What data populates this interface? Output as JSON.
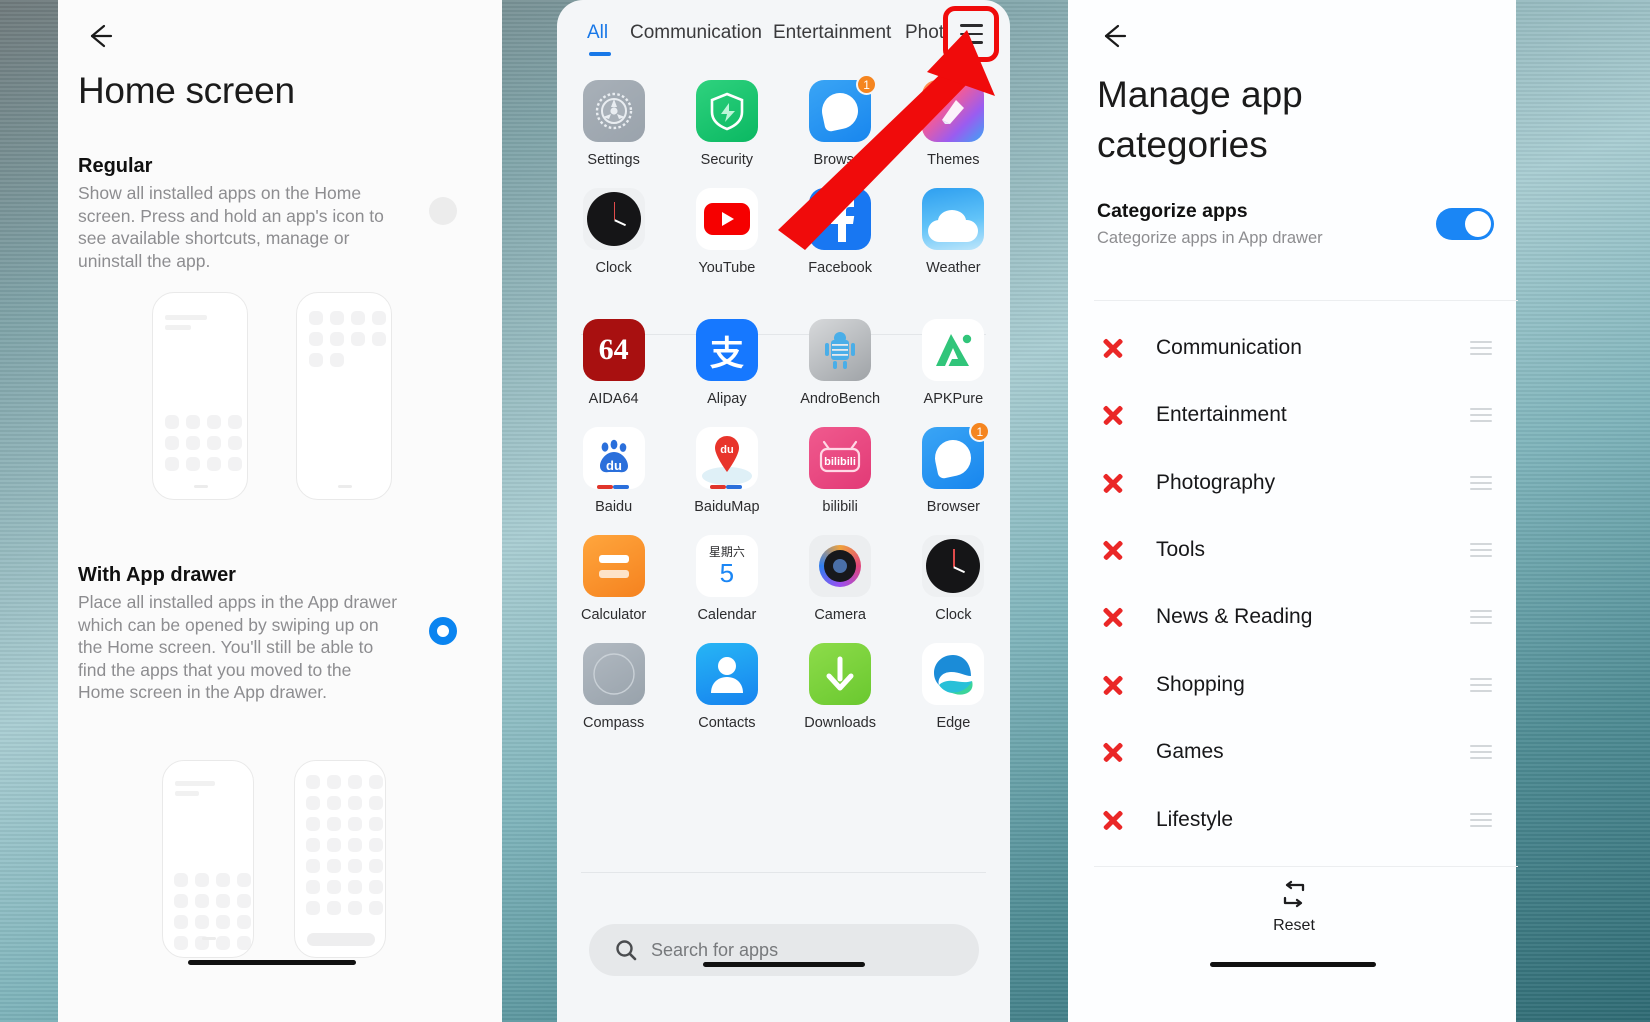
{
  "left_panel": {
    "back_icon": "back-arrow-icon",
    "title": "Home screen",
    "options": [
      {
        "heading": "Regular",
        "body": "Show all installed apps on the Home screen. Press and hold an app's icon to see available shortcuts, manage or uninstall the app.",
        "selected": false
      },
      {
        "heading": "With App drawer",
        "body": "Place all installed apps in the App drawer which can be opened by swiping up on the Home screen. You'll still be able to find the apps that you moved to the Home screen in the App drawer.",
        "selected": true
      }
    ]
  },
  "middle_panel": {
    "tabs": [
      {
        "label": "All",
        "active": true
      },
      {
        "label": "Communication",
        "active": false
      },
      {
        "label": "Entertainment",
        "active": false
      },
      {
        "label": "Phot",
        "active": false
      }
    ],
    "menu_icon": "hamburger-menu-icon",
    "menu_highlight_color": "#f00b0b",
    "apps": [
      {
        "label": "Settings",
        "icon": "settings-gear-icon",
        "badge": null
      },
      {
        "label": "Security",
        "icon": "shield-icon",
        "badge": null
      },
      {
        "label": "Browser",
        "icon": "browser-icon",
        "badge": "1"
      },
      {
        "label": "Themes",
        "icon": "themes-icon",
        "badge": null
      },
      {
        "label": "Clock",
        "icon": "clock-icon",
        "badge": null
      },
      {
        "label": "YouTube",
        "icon": "youtube-icon",
        "badge": null
      },
      {
        "label": "Facebook",
        "icon": "facebook-icon",
        "badge": null
      },
      {
        "label": "Weather",
        "icon": "weather-icon",
        "badge": null
      },
      {
        "label": "AIDA64",
        "icon": "aida64-icon",
        "badge": null
      },
      {
        "label": "Alipay",
        "icon": "alipay-icon",
        "badge": null
      },
      {
        "label": "AndroBench",
        "icon": "androbench-icon",
        "badge": null
      },
      {
        "label": "APKPure",
        "icon": "apkpure-icon",
        "badge": null
      },
      {
        "label": "Baidu",
        "icon": "baidu-icon",
        "badge": null
      },
      {
        "label": "BaiduMap",
        "icon": "baidumap-icon",
        "badge": null
      },
      {
        "label": "bilibili",
        "icon": "bilibili-icon",
        "badge": null
      },
      {
        "label": "Browser",
        "icon": "browser-icon",
        "badge": "1"
      },
      {
        "label": "Calculator",
        "icon": "calculator-icon",
        "badge": null
      },
      {
        "label": "Calendar",
        "icon": "calendar-icon",
        "badge": null
      },
      {
        "label": "Camera",
        "icon": "camera-icon",
        "badge": null
      },
      {
        "label": "Clock",
        "icon": "clock-icon",
        "badge": null
      },
      {
        "label": "Compass",
        "icon": "compass-icon",
        "badge": null
      },
      {
        "label": "Contacts",
        "icon": "contacts-icon",
        "badge": null
      },
      {
        "label": "Downloads",
        "icon": "downloads-icon",
        "badge": null
      },
      {
        "label": "Edge",
        "icon": "edge-icon",
        "badge": null
      }
    ],
    "icon_text": {
      "aida64": "64",
      "alipay": "支",
      "baidu": "du",
      "baidumap": "du",
      "bilibili": "bilibili",
      "calendar_weekday": "星期六",
      "calendar_day": "5"
    },
    "search": {
      "icon": "search-icon",
      "placeholder": "Search for apps",
      "value": ""
    }
  },
  "right_panel": {
    "back_icon": "back-arrow-icon",
    "title": "Manage app categories",
    "setting": {
      "label": "Categorize apps",
      "description": "Categorize apps in App drawer",
      "toggle_on": true,
      "toggle_color": "#1a86f5"
    },
    "categories": [
      {
        "name": "Communication",
        "remove_icon": "remove-x-icon",
        "drag_icon": "drag-handle-icon"
      },
      {
        "name": "Entertainment",
        "remove_icon": "remove-x-icon",
        "drag_icon": "drag-handle-icon"
      },
      {
        "name": "Photography",
        "remove_icon": "remove-x-icon",
        "drag_icon": "drag-handle-icon"
      },
      {
        "name": "Tools",
        "remove_icon": "remove-x-icon",
        "drag_icon": "drag-handle-icon"
      },
      {
        "name": "News & Reading",
        "remove_icon": "remove-x-icon",
        "drag_icon": "drag-handle-icon"
      },
      {
        "name": "Shopping",
        "remove_icon": "remove-x-icon",
        "drag_icon": "drag-handle-icon"
      },
      {
        "name": "Games",
        "remove_icon": "remove-x-icon",
        "drag_icon": "drag-handle-icon"
      },
      {
        "name": "Lifestyle",
        "remove_icon": "remove-x-icon",
        "drag_icon": "drag-handle-icon"
      }
    ],
    "reset": {
      "label": "Reset",
      "icon": "reset-loop-icon"
    }
  },
  "annotation": {
    "arrow_color": "#f00b0b",
    "points_to": "hamburger-menu-icon"
  }
}
